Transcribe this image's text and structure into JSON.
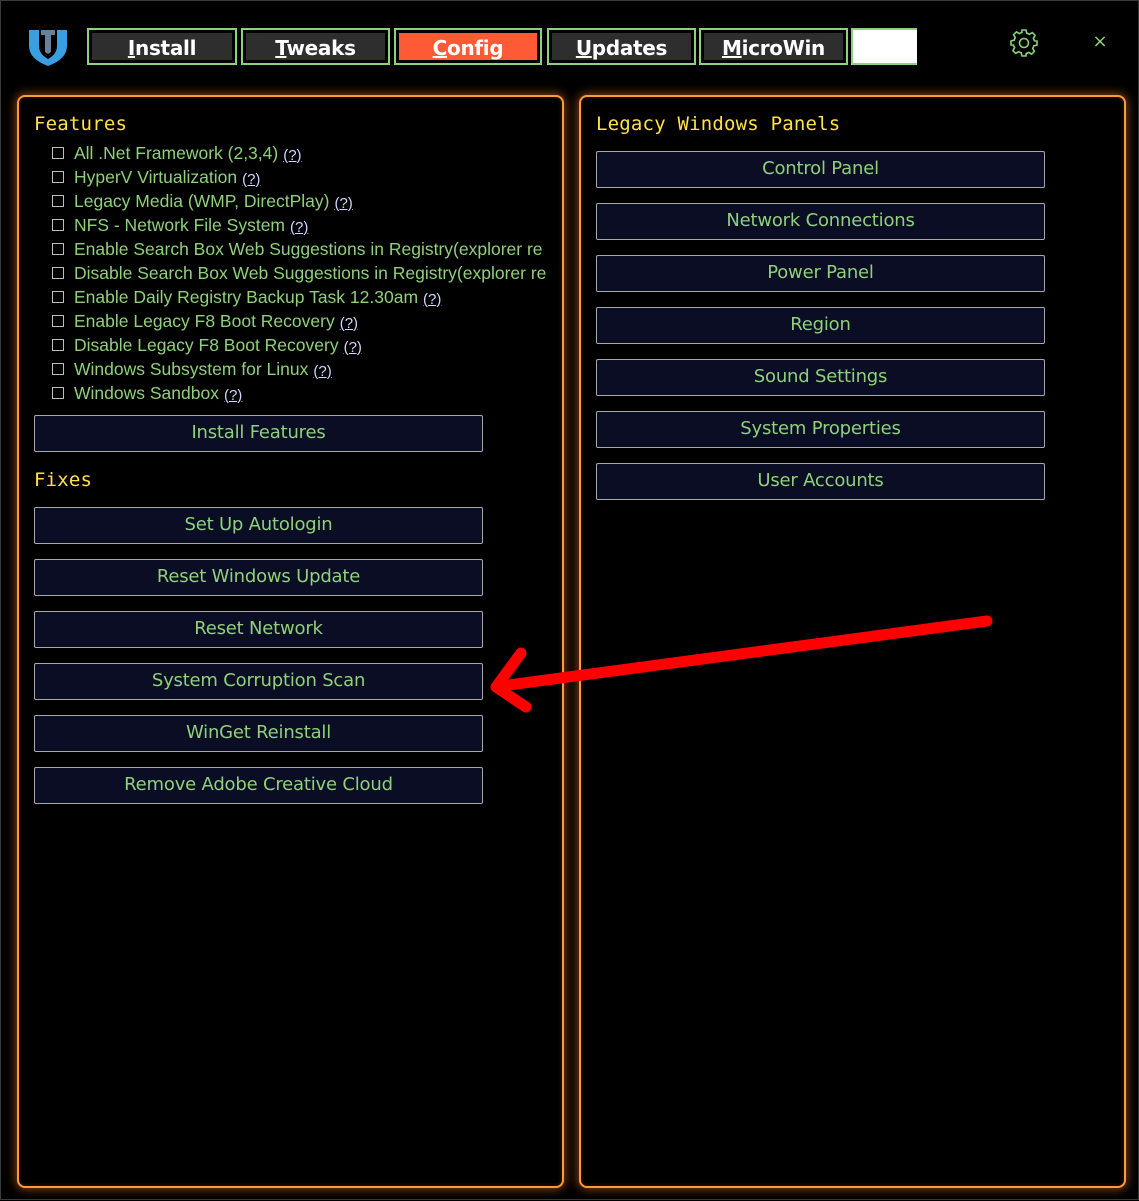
{
  "nav": {
    "tabs": [
      {
        "first": "I",
        "rest": "nstall",
        "active": false
      },
      {
        "first": "T",
        "rest": "weaks",
        "active": false
      },
      {
        "first": "C",
        "rest": "onfig",
        "active": true
      },
      {
        "first": "U",
        "rest": "pdates",
        "active": false
      },
      {
        "first": "M",
        "rest": "icroWin",
        "active": false
      }
    ],
    "search_value": "",
    "close_glyph": "×"
  },
  "left": {
    "features_title": "Features",
    "help_text": "(?)",
    "features": [
      {
        "label": "All .Net Framework (2,3,4)",
        "checked": false
      },
      {
        "label": "HyperV Virtualization",
        "checked": false
      },
      {
        "label": "Legacy Media (WMP, DirectPlay)",
        "checked": false
      },
      {
        "label": "NFS - Network File System",
        "checked": false
      },
      {
        "label": "Enable Search Box Web Suggestions in Registry(explorer re",
        "checked": false
      },
      {
        "label": "Disable Search Box Web Suggestions in Registry(explorer re",
        "checked": false
      },
      {
        "label": "Enable Daily Registry Backup Task 12.30am",
        "checked": false
      },
      {
        "label": "Enable Legacy F8 Boot Recovery",
        "checked": false
      },
      {
        "label": "Disable Legacy F8 Boot Recovery",
        "checked": false
      },
      {
        "label": "Windows Subsystem for Linux",
        "checked": false
      },
      {
        "label": "Windows Sandbox",
        "checked": false
      }
    ],
    "install_button": "Install Features",
    "fixes_title": "Fixes",
    "fixes": [
      "Set Up Autologin",
      "Reset Windows Update",
      "Reset Network",
      "System Corruption Scan",
      "WinGet Reinstall",
      "Remove Adobe Creative Cloud"
    ]
  },
  "right": {
    "title": "Legacy Windows Panels",
    "panels": [
      "Control Panel",
      "Network Connections",
      "Power Panel",
      "Region",
      "Sound Settings",
      "System Properties",
      "User Accounts"
    ]
  },
  "colors": {
    "accent_green": "#8fd07a",
    "title_yellow": "#ffe24a",
    "panel_border": "#ff9a3a",
    "active_tab": "#ff5a36",
    "annotation_arrow": "#ff0000"
  },
  "icons": {
    "logo": "winutil-logo-icon",
    "settings": "gear-icon",
    "close": "close-icon",
    "annotation": "red-arrow-annotation"
  }
}
